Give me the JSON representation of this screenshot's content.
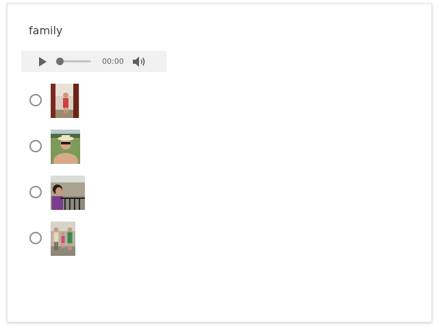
{
  "question": {
    "title": "family"
  },
  "audio_player": {
    "time": "00:00",
    "icons": {
      "play": "play-icon",
      "volume": "volume-icon"
    }
  },
  "options": [
    {
      "image": "photo-child-red-pillars"
    },
    {
      "image": "photo-man-sunglasses-hat"
    },
    {
      "image": "photo-woman-balcony-railing"
    },
    {
      "image": "photo-family-group"
    }
  ],
  "colors": {
    "accent": "#606060",
    "player_bg": "#f1f1f1",
    "radio_border": "#8c8c8c"
  }
}
